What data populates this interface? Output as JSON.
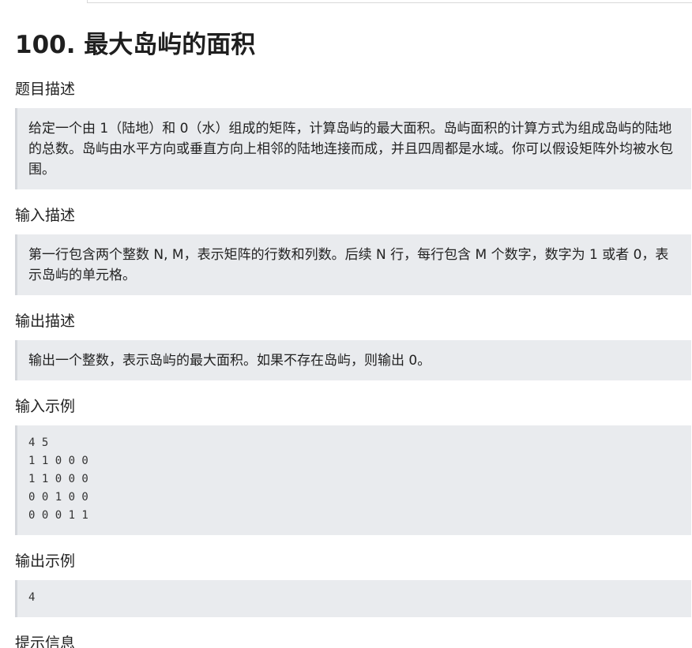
{
  "problem": {
    "title": "100. 最大岛屿的面积"
  },
  "sections": {
    "description": {
      "heading": "题目描述",
      "text": "给定一个由 1（陆地）和 0（水）组成的矩阵，计算岛屿的最大面积。岛屿面积的计算方式为组成岛屿的陆地的总数。岛屿由水平方向或垂直方向上相邻的陆地连接而成，并且四周都是水域。你可以假设矩阵外均被水包围。"
    },
    "input_description": {
      "heading": "输入描述",
      "text": "第一行包含两个整数 N, M，表示矩阵的行数和列数。后续 N 行，每行包含 M 个数字，数字为 1 或者 0，表示岛屿的单元格。"
    },
    "output_description": {
      "heading": "输出描述",
      "text": "输出一个整数，表示岛屿的最大面积。如果不存在岛屿，则输出 0。"
    },
    "input_example": {
      "heading": "输入示例",
      "lines": [
        "4 5",
        "1 1 0 0 0",
        "1 1 0 0 0",
        "0 0 1 0 0",
        "0 0 0 1 1"
      ]
    },
    "output_example": {
      "heading": "输出示例",
      "lines": [
        "4"
      ]
    },
    "hint": {
      "heading": "提示信息"
    }
  }
}
